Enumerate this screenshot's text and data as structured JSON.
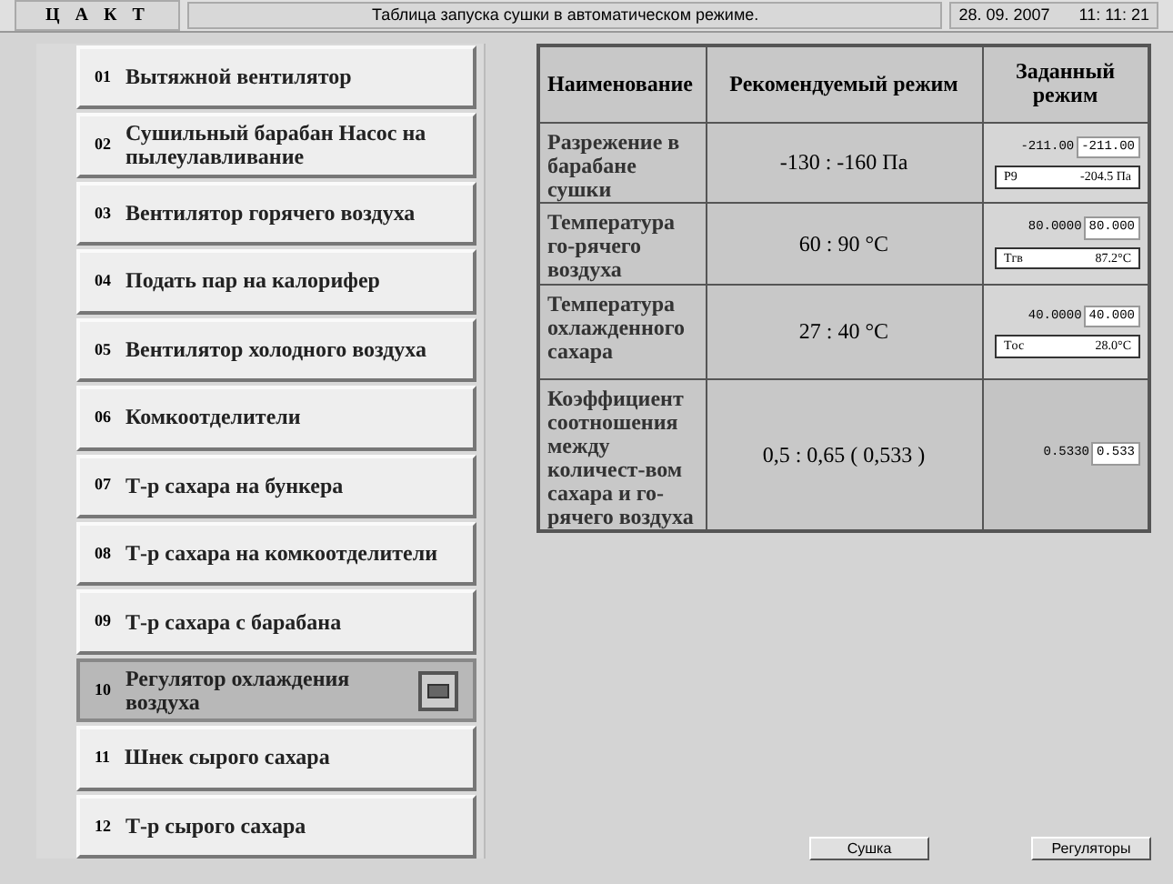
{
  "title_bar": {
    "logo": "Ц А К Т",
    "title": "Таблица запуска сушки в автоматическом режиме.",
    "date": "28. 09. 2007",
    "time": "11: 11: 21"
  },
  "menu_items": [
    {
      "number": "01",
      "label": "Вытяжной вентилятор",
      "selected": false
    },
    {
      "number": "02",
      "label": "Сушильный барабан Насос на пылеулавливание",
      "selected": false
    },
    {
      "number": "03",
      "label": "Вентилятор горячего воздуха",
      "selected": false
    },
    {
      "number": "04",
      "label": "Подать пар на калорифер",
      "selected": false
    },
    {
      "number": "05",
      "label": "Вентилятор холодного воздуха",
      "selected": false
    },
    {
      "number": "06",
      "label": "Комкоотделители",
      "selected": false
    },
    {
      "number": "07",
      "label": "Т-р сахара на бункера",
      "selected": false
    },
    {
      "number": "08",
      "label": "Т-р сахара на комкоотделители",
      "selected": false
    },
    {
      "number": "09",
      "label": "Т-р сахара с барабана",
      "selected": false
    },
    {
      "number": "10",
      "label": "Регулятор охлаждения воздуха",
      "selected": true
    },
    {
      "number": "11",
      "label": "Шнек сырого сахара",
      "selected": false
    },
    {
      "number": "12",
      "label": "Т-р сырого сахара",
      "selected": false
    }
  ],
  "table": {
    "columns": [
      "Наименование",
      "Рекомендуемый режим",
      "Заданный режим"
    ],
    "rows": [
      {
        "name": "Разрежение в барабане сушки",
        "recommended": "-130 : -160 Па",
        "set_value": "-211.00",
        "set_input": "-211.00",
        "reading_label": "P9",
        "reading": "-204.5 Па"
      },
      {
        "name": "Температура го-рячего воздуха",
        "recommended": "60 : 90 °C",
        "set_value": "80.0000",
        "set_input": "80.000",
        "reading_label": "Tгв",
        "reading": "87.2°C"
      },
      {
        "name": "Температура охлажденного сахара",
        "recommended": "27 : 40 °C",
        "set_value": "40.0000",
        "set_input": "40.000",
        "reading_label": "Tос",
        "reading": "28.0°C"
      },
      {
        "name": "Коэффициент соотношения между количест-вом сахара и го-рячего воздуха",
        "recommended": "0,5 : 0,65 ( 0,533 )",
        "set_value": "0.5330",
        "set_input": "0.533"
      }
    ]
  },
  "buttons": [
    "Сушка",
    "Регуляторы"
  ]
}
